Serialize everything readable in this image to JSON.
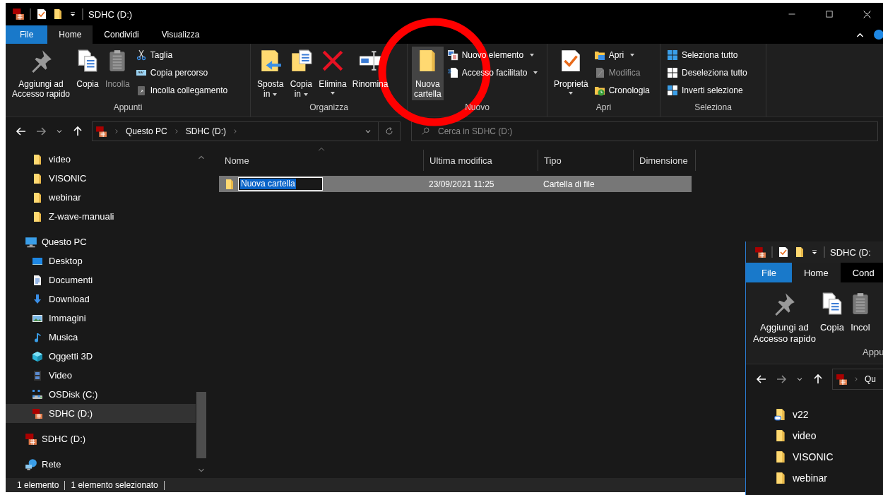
{
  "window": {
    "title": "SDHC (D:)"
  },
  "ribbon_tabs": [
    {
      "label": "File",
      "kind": "menu",
      "selected": false
    },
    {
      "label": "Home",
      "kind": "tab",
      "selected": true
    },
    {
      "label": "Condividi",
      "kind": "tab",
      "selected": false
    },
    {
      "label": "Visualizza",
      "kind": "tab",
      "selected": false
    }
  ],
  "ribbon_groups": [
    {
      "label": "Appunti",
      "large": [
        {
          "lines": [
            "Aggiungi ad",
            "Accesso rapido"
          ],
          "dropdown": false,
          "highlighted": false,
          "disabled": false
        },
        {
          "lines": [
            "Copia"
          ],
          "dropdown": false,
          "highlighted": false,
          "disabled": false
        },
        {
          "lines": [
            "Incolla"
          ],
          "dropdown": false,
          "highlighted": false,
          "disabled": true
        }
      ],
      "small": [
        {
          "label": "Taglia",
          "dropdown": false,
          "disabled": false
        },
        {
          "label": "Copia percorso",
          "dropdown": false,
          "disabled": false
        },
        {
          "label": "Incolla collegamento",
          "dropdown": false,
          "disabled": false
        }
      ]
    },
    {
      "label": "Organizza",
      "large": [
        {
          "lines": [
            "Sposta",
            "in"
          ],
          "dropdown": true,
          "highlighted": false,
          "disabled": false
        },
        {
          "lines": [
            "Copia",
            "in"
          ],
          "dropdown": true,
          "highlighted": false,
          "disabled": false
        },
        {
          "lines": [
            "Elimina"
          ],
          "dropdown": true,
          "highlighted": false,
          "disabled": false
        },
        {
          "lines": [
            "Rinomina"
          ],
          "dropdown": false,
          "highlighted": false,
          "disabled": false
        }
      ]
    },
    {
      "label": "Nuovo",
      "large": [
        {
          "lines": [
            "Nuova",
            "cartella"
          ],
          "dropdown": false,
          "highlighted": true,
          "disabled": false
        }
      ],
      "small": [
        {
          "label": "Nuovo elemento",
          "dropdown": true,
          "disabled": false
        },
        {
          "label": "Accesso facilitato",
          "dropdown": true,
          "disabled": false
        }
      ]
    },
    {
      "label": "Apri",
      "large": [
        {
          "lines": [
            "Proprietà"
          ],
          "dropdown": true,
          "highlighted": false,
          "disabled": false
        }
      ],
      "small": [
        {
          "label": "Apri",
          "dropdown": true,
          "disabled": false
        },
        {
          "label": "Modifica",
          "dropdown": false,
          "disabled": true
        },
        {
          "label": "Cronologia",
          "dropdown": false,
          "disabled": false
        }
      ]
    },
    {
      "label": "Seleziona",
      "small": [
        {
          "label": "Seleziona tutto",
          "dropdown": false,
          "disabled": false
        },
        {
          "label": "Deseleziona tutto",
          "dropdown": false,
          "disabled": false
        },
        {
          "label": "Inverti selezione",
          "dropdown": false,
          "disabled": false
        }
      ]
    }
  ],
  "address": {
    "breadcrumbs": [
      "Questo PC",
      "SDHC (D:)"
    ],
    "search_placeholder": "Cerca in SDHC (D:)"
  },
  "sidebar": {
    "quick_access": [
      {
        "label": "video",
        "kind": "folder",
        "selected": false
      },
      {
        "label": "VISONIC",
        "kind": "folder",
        "selected": false
      },
      {
        "label": "webinar",
        "kind": "folder",
        "selected": false
      },
      {
        "label": "Z-wave-manuali",
        "kind": "folder",
        "selected": false
      }
    ],
    "tree": [
      {
        "label": "Questo PC",
        "kind": "pc",
        "selected": false,
        "children": [
          {
            "label": "Desktop",
            "kind": "desktop",
            "selected": false
          },
          {
            "label": "Documenti",
            "kind": "documents",
            "selected": false
          },
          {
            "label": "Download",
            "kind": "downloads",
            "selected": false
          },
          {
            "label": "Immagini",
            "kind": "pictures",
            "selected": false
          },
          {
            "label": "Musica",
            "kind": "music",
            "selected": false
          },
          {
            "label": "Oggetti 3D",
            "kind": "objects",
            "selected": false
          },
          {
            "label": "Video",
            "kind": "videos",
            "selected": false
          },
          {
            "label": "OSDisk (C:)",
            "kind": "disk",
            "selected": false
          },
          {
            "label": "SDHC (D:)",
            "kind": "card",
            "selected": true
          }
        ]
      },
      {
        "label": "SDHC (D:)",
        "kind": "card",
        "selected": false
      },
      {
        "label": "Rete",
        "kind": "network",
        "selected": false
      }
    ]
  },
  "columns": [
    {
      "label": "Nome",
      "sorted": true
    },
    {
      "label": "Ultima modifica",
      "sorted": false
    },
    {
      "label": "Tipo",
      "sorted": false
    },
    {
      "label": "Dimensione",
      "sorted": false
    }
  ],
  "rows": [
    {
      "name": "Nuova cartella",
      "modified": "23/09/2021 11:25",
      "type": "Cartella di file",
      "selected": true,
      "renaming": true
    }
  ],
  "status_bar": [
    "1 elemento",
    "1 elemento selezionato"
  ],
  "second_window": {
    "title": "SDHC (D:",
    "tabs": [
      {
        "label": "File",
        "kind": "menu",
        "selected": false
      },
      {
        "label": "Home",
        "kind": "tab",
        "selected": true
      },
      {
        "label": "Cond",
        "kind": "tab",
        "selected": false
      }
    ],
    "ribbon_buttons": [
      {
        "lines": [
          "Aggiungi ad",
          "Accesso rapido"
        ]
      },
      {
        "lines": [
          "Copia"
        ]
      },
      {
        "lines": [
          "Incol"
        ]
      }
    ],
    "group_label": "Appu",
    "breadcrumb": "Qu",
    "sidebar": [
      {
        "label": "v22",
        "kind": "linked-folder"
      },
      {
        "label": "video",
        "kind": "folder"
      },
      {
        "label": "VISONIC",
        "kind": "folder"
      },
      {
        "label": "webinar",
        "kind": "folder"
      }
    ]
  }
}
